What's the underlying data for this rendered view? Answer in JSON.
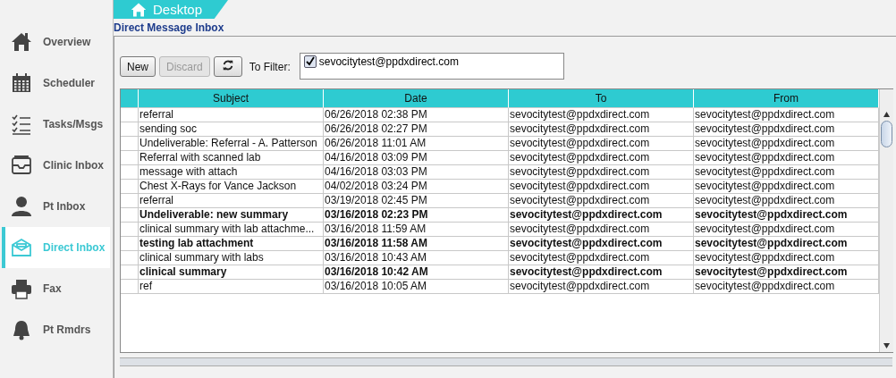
{
  "tab": {
    "label": "Desktop"
  },
  "sidebar": {
    "items": [
      {
        "label": "Overview",
        "kind": "home",
        "selected": false
      },
      {
        "label": "Scheduler",
        "kind": "calendar",
        "selected": false
      },
      {
        "label": "Tasks/Msgs",
        "kind": "checklist",
        "selected": false
      },
      {
        "label": "Clinic Inbox",
        "kind": "inbox",
        "selected": false
      },
      {
        "label": "Pt Inbox",
        "kind": "person",
        "selected": false
      },
      {
        "label": "Direct Inbox",
        "kind": "envelope",
        "selected": true
      },
      {
        "label": "Fax",
        "kind": "printer",
        "selected": false
      },
      {
        "label": "Pt Rmdrs",
        "kind": "bell",
        "selected": false
      }
    ]
  },
  "panel_title": "Direct Message Inbox",
  "toolbar": {
    "buttons": [
      {
        "label": "New",
        "disabled": false
      },
      {
        "label": "Discard",
        "disabled": true
      }
    ],
    "filter_label": "To Filter:",
    "filter_items": [
      {
        "label": "sevocitytest@ppdxdirect.com",
        "checked": true
      }
    ]
  },
  "table": {
    "columns": [
      "Subject",
      "Date",
      "To",
      "From"
    ],
    "rows": [
      {
        "subject": "referral",
        "date": "06/26/2018 02:38 PM",
        "to": "sevocitytest@ppdxdirect.com",
        "from": "sevocitytest@ppdxdirect.com",
        "unread": false
      },
      {
        "subject": "sending soc",
        "date": "06/26/2018 02:27 PM",
        "to": "sevocitytest@ppdxdirect.com",
        "from": "sevocitytest@ppdxdirect.com",
        "unread": false
      },
      {
        "subject": "Undeliverable: Referral - A. Patterson",
        "date": "06/26/2018 11:01 AM",
        "to": "sevocitytest@ppdxdirect.com",
        "from": "sevocitytest@ppdxdirect.com",
        "unread": false
      },
      {
        "subject": "Referral with scanned lab",
        "date": "04/16/2018 03:09 PM",
        "to": "sevocitytest@ppdxdirect.com",
        "from": "sevocitytest@ppdxdirect.com",
        "unread": false
      },
      {
        "subject": "message with attach",
        "date": "04/16/2018 03:03 PM",
        "to": "sevocitytest@ppdxdirect.com",
        "from": "sevocitytest@ppdxdirect.com",
        "unread": false
      },
      {
        "subject": "Chest X-Rays for Vance Jackson",
        "date": "04/02/2018 03:24 PM",
        "to": "sevocitytest@ppdxdirect.com",
        "from": "sevocitytest@ppdxdirect.com",
        "unread": false
      },
      {
        "subject": "referral",
        "date": "03/19/2018 02:45 PM",
        "to": "sevocitytest@ppdxdirect.com",
        "from": "sevocitytest@ppdxdirect.com",
        "unread": false
      },
      {
        "subject": "Undeliverable: new summary",
        "date": "03/16/2018 02:23 PM",
        "to": "sevocitytest@ppdxdirect.com",
        "from": "sevocitytest@ppdxdirect.com",
        "unread": true
      },
      {
        "subject": "clinical summary with lab attachme...",
        "date": "03/16/2018 11:59 AM",
        "to": "sevocitytest@ppdxdirect.com",
        "from": "sevocitytest@ppdxdirect.com",
        "unread": false
      },
      {
        "subject": "testing lab attachment",
        "date": "03/16/2018 11:58 AM",
        "to": "sevocitytest@ppdxdirect.com",
        "from": "sevocitytest@ppdxdirect.com",
        "unread": true
      },
      {
        "subject": "clinical summary with labs",
        "date": "03/16/2018 10:43 AM",
        "to": "sevocitytest@ppdxdirect.com",
        "from": "sevocitytest@ppdxdirect.com",
        "unread": false
      },
      {
        "subject": "clinical summary",
        "date": "03/16/2018 10:42 AM",
        "to": "sevocitytest@ppdxdirect.com",
        "from": "sevocitytest@ppdxdirect.com",
        "unread": true
      },
      {
        "subject": "ref",
        "date": "03/16/2018 10:05 AM",
        "to": "sevocitytest@ppdxdirect.com",
        "from": "sevocitytest@ppdxdirect.com",
        "unread": false
      }
    ]
  }
}
